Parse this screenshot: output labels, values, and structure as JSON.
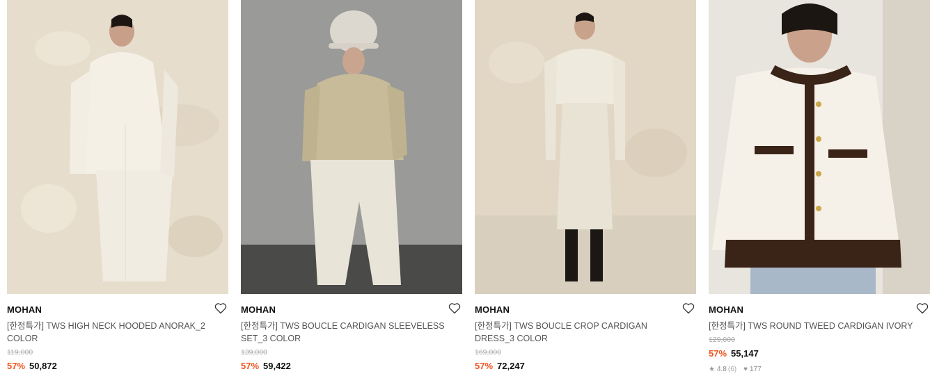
{
  "products": [
    {
      "brand": "MOHAN",
      "title": "[한정특가] TWS HIGH NECK HOODED ANORAK_2 COLOR",
      "original_price": "119,000",
      "discount": "57%",
      "price": "50,872",
      "wishlist_icon": "heart-outline-icon"
    },
    {
      "brand": "MOHAN",
      "title": "[한정특가] TWS BOUCLE CARDIGAN SLEEVELESS SET_3 COLOR",
      "original_price": "139,000",
      "discount": "57%",
      "price": "59,422",
      "wishlist_icon": "heart-outline-icon"
    },
    {
      "brand": "MOHAN",
      "title": "[한정특가] TWS BOUCLE CROP CARDIGAN DRESS_3 COLOR",
      "original_price": "169,000",
      "discount": "57%",
      "price": "72,247",
      "wishlist_icon": "heart-outline-icon"
    },
    {
      "brand": "MOHAN",
      "title": "[한정특가] TWS ROUND TWEED CARDIGAN IVORY",
      "original_price": "129,000",
      "discount": "57%",
      "price": "55,147",
      "rating": "4.8",
      "review_count": "(6)",
      "likes": "177",
      "wishlist_icon": "heart-outline-icon"
    }
  ],
  "colors": {
    "discount": "#f0541e",
    "brand_text": "#111111",
    "title_text": "#555555",
    "strike_price": "#aaaaaa"
  }
}
